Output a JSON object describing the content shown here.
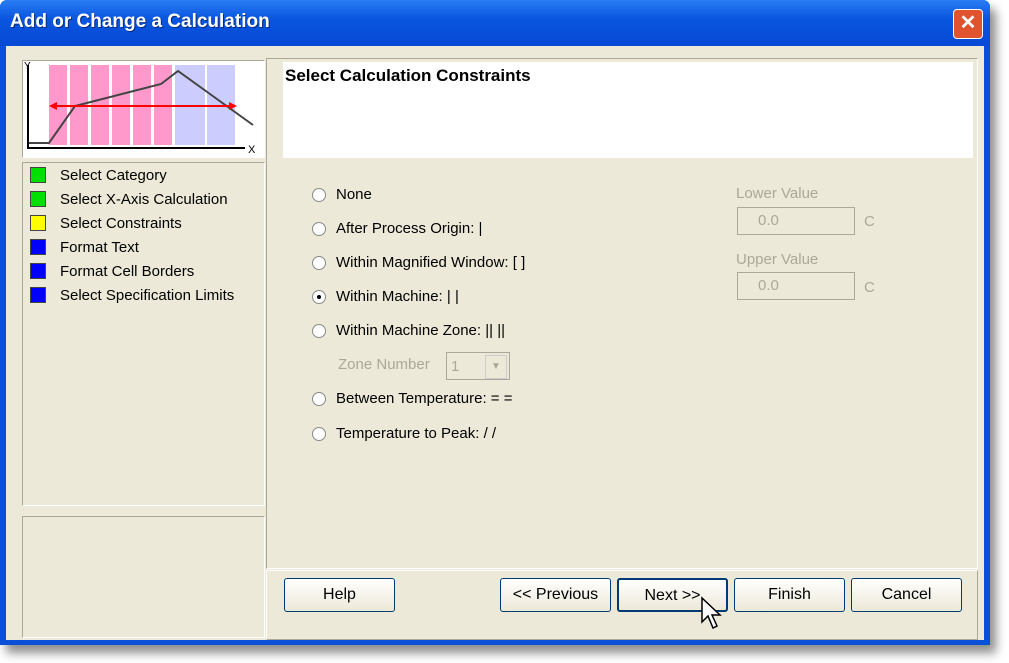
{
  "window": {
    "title": "Add or Change a Calculation"
  },
  "steps": [
    {
      "label": "Select Category",
      "color": "#00e000"
    },
    {
      "label": "Select X-Axis Calculation",
      "color": "#00e000"
    },
    {
      "label": "Select Constraints",
      "color": "#ffff00"
    },
    {
      "label": "Format Text",
      "color": "#0000ff"
    },
    {
      "label": "Format Cell Borders",
      "color": "#0000ff"
    },
    {
      "label": "Select Specification Limits",
      "color": "#0000ff"
    }
  ],
  "diagram": {
    "y_label": "Y",
    "x_label": "X"
  },
  "header": {
    "title": "Select Calculation Constraints"
  },
  "options": [
    {
      "label": "None",
      "selected": false
    },
    {
      "label": "After Process Origin: |",
      "selected": false
    },
    {
      "label": "Within Magnified Window: [  ]",
      "selected": false
    },
    {
      "label": "Within Machine: |  |",
      "selected": true
    },
    {
      "label": "Within Machine Zone: ||  ||",
      "selected": false
    },
    {
      "label": "Between Temperature: =  =",
      "selected": false
    },
    {
      "label": "Temperature to Peak: /  /",
      "selected": false
    }
  ],
  "zone": {
    "label": "Zone Number",
    "value": "1"
  },
  "lower": {
    "label": "Lower Value",
    "value": "0.0",
    "unit": "C"
  },
  "upper": {
    "label": "Upper Value",
    "value": "0.0",
    "unit": "C"
  },
  "buttons": {
    "help": "Help",
    "previous": "<< Previous",
    "next": "Next >>",
    "finish": "Finish",
    "cancel": "Cancel"
  }
}
